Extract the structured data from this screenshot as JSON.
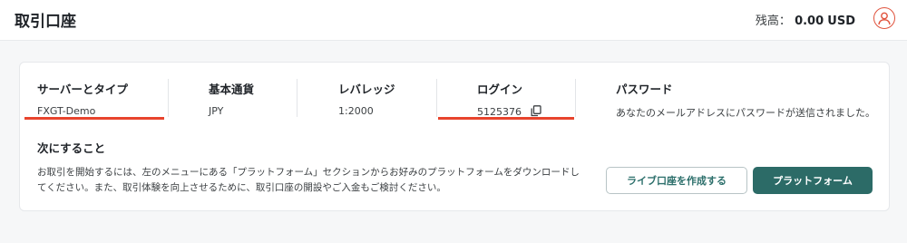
{
  "header": {
    "title": "取引口座",
    "balance_label": "残高：",
    "balance_amount": "0.00",
    "balance_currency": "USD"
  },
  "account": {
    "server": {
      "label": "サーバーとタイプ",
      "value": "FXGT-Demo"
    },
    "currency": {
      "label": "基本通貨",
      "value": "JPY"
    },
    "leverage": {
      "label": "レバレッジ",
      "value": "1:2000"
    },
    "login": {
      "label": "ログイン",
      "value": "5125376"
    },
    "password": {
      "label": "パスワード",
      "value": "あなたのメールアドレスにパスワードが送信されました。"
    }
  },
  "next_steps": {
    "title": "次にすること",
    "line1": "お取引を開始するには、左のメニューにある「プラットフォーム」セクションからお好みのプラットフォームをダウンロードし",
    "line2": "てください。また、取引体験を向上させるために、取引口座の開設やご入金もご検討ください。"
  },
  "buttons": {
    "live_account": "ライブ口座を作成する",
    "platform": "プラットフォーム"
  },
  "colors": {
    "accent_teal": "#2c6b67",
    "highlight_red": "#e8442d",
    "avatar_red": "#e0533d"
  },
  "icons": {
    "copy": "copy-icon",
    "avatar": "user-avatar-icon"
  }
}
